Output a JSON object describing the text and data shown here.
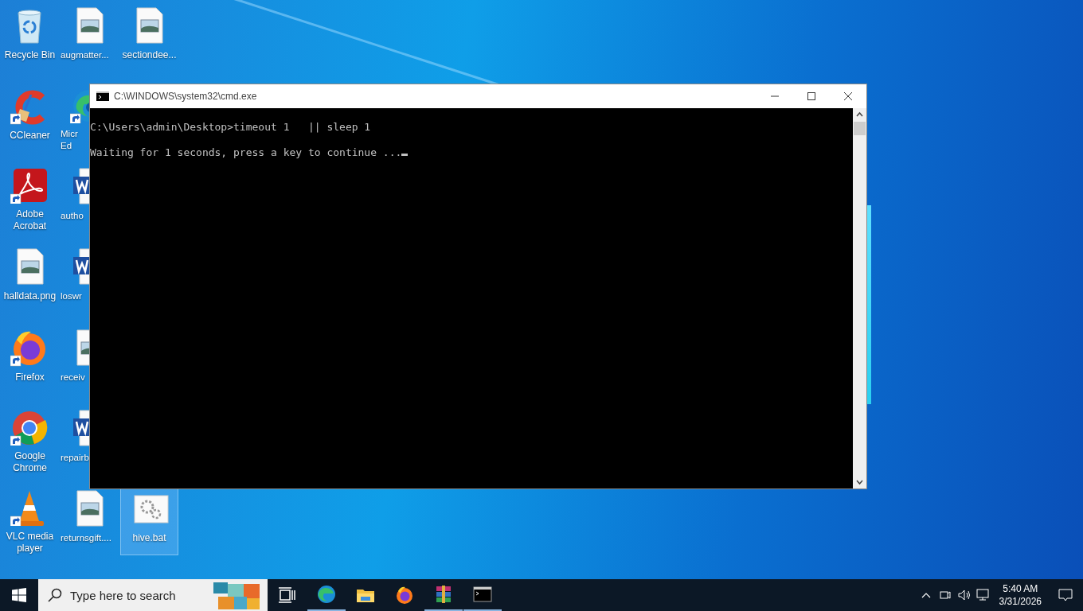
{
  "desktop_columns": [
    [
      {
        "label": "Recycle Bin",
        "kind": "recycle",
        "shortcut": false,
        "selected": false
      },
      {
        "label": "CCleaner",
        "kind": "ccleaner",
        "shortcut": true,
        "selected": false
      },
      {
        "label": "Adobe Acrobat",
        "kind": "acrobat",
        "shortcut": true,
        "selected": false
      },
      {
        "label": "halldata.png",
        "kind": "image",
        "shortcut": false,
        "selected": false
      },
      {
        "label": "Firefox",
        "kind": "firefox",
        "shortcut": true,
        "selected": false
      },
      {
        "label": "Google Chrome",
        "kind": "chrome",
        "shortcut": true,
        "selected": false
      },
      {
        "label": "VLC media player",
        "kind": "vlc",
        "shortcut": true,
        "selected": false
      }
    ],
    [
      {
        "label": "augmatter...",
        "kind": "image",
        "shortcut": false,
        "selected": false
      },
      {
        "label": "Micr\nEd",
        "kind": "edge",
        "shortcut": true,
        "selected": false
      },
      {
        "label": "autho",
        "kind": "word",
        "shortcut": false,
        "selected": false
      },
      {
        "label": "loswr",
        "kind": "word",
        "shortcut": false,
        "selected": false
      },
      {
        "label": "receiv",
        "kind": "image",
        "shortcut": false,
        "selected": false
      },
      {
        "label": "repairb",
        "kind": "word",
        "shortcut": false,
        "selected": false
      },
      {
        "label": "returnsgift....",
        "kind": "image",
        "shortcut": false,
        "selected": false
      }
    ],
    [
      {
        "label": "sectiondee...",
        "kind": "image",
        "shortcut": false,
        "selected": false
      },
      {
        "label": "hive.bat",
        "kind": "bat",
        "shortcut": false,
        "selected": true
      }
    ]
  ],
  "window": {
    "title": "C:\\WINDOWS\\system32\\cmd.exe",
    "lines": [
      "C:\\Users\\admin\\Desktop>timeout 1   || sleep 1",
      "Waiting for 1 seconds, press a key to continue ..."
    ]
  },
  "taskbar": {
    "search": {
      "placeholder": "Type here to search"
    },
    "apps": [
      {
        "kind": "taskview",
        "running": false
      },
      {
        "kind": "edge",
        "running": true
      },
      {
        "kind": "explorer",
        "running": false
      },
      {
        "kind": "firefox",
        "running": false
      },
      {
        "kind": "winrar",
        "running": true
      },
      {
        "kind": "cmd",
        "running": true
      }
    ],
    "clock": {
      "time": "5:40 AM",
      "date": "3/31/2026"
    }
  }
}
